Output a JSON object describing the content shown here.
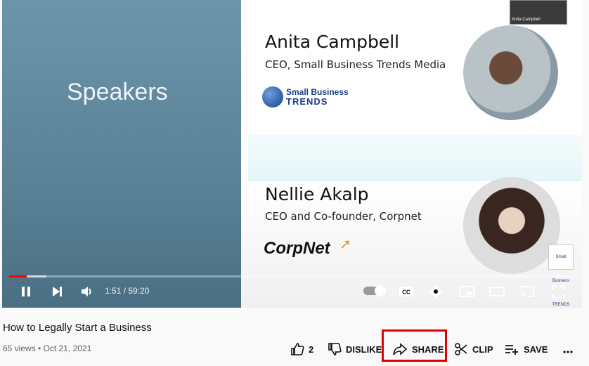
{
  "video": {
    "left_heading": "Speakers",
    "webcam_label": "Anita Campbell",
    "speaker1": {
      "name": "Anita Campbell",
      "role": "CEO, Small Business Trends Media"
    },
    "speaker2": {
      "name": "Nellie Akalp",
      "role": "CEO and Co-founder, Corpnet"
    },
    "logo1": {
      "line1": "Small Business",
      "line2": "TRENDS"
    },
    "logo2": "CorpNet",
    "corner_logo": "Small Business TRENDS"
  },
  "player": {
    "progress_played_fraction": 0.031,
    "progress_loaded_fraction": 0.066,
    "time": "1:51 / 59:20",
    "icons": [
      "pause-icon",
      "next-icon",
      "volume-icon",
      "autoplay-toggle",
      "cc-icon",
      "settings-icon",
      "miniplayer-icon",
      "theater-icon",
      "cast-icon",
      "fullscreen-icon"
    ]
  },
  "info": {
    "title": "How to Legally Start a Business",
    "meta": "65 views • Oct 21, 2021"
  },
  "actions": {
    "like_count": "2",
    "dislike": "DISLIKE",
    "share": "SHARE",
    "clip": "CLIP",
    "save": "SAVE"
  },
  "colors": {
    "accent": "#ff0000",
    "highlight_box": "#e10000"
  }
}
